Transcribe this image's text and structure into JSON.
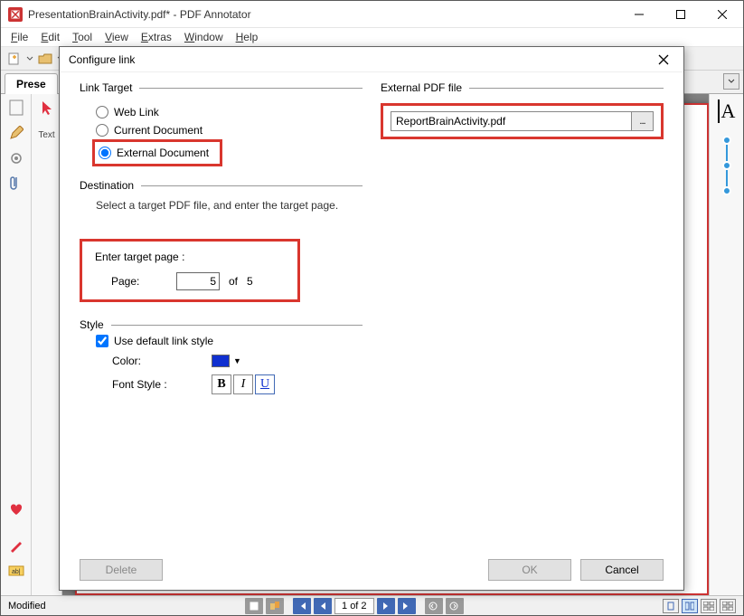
{
  "titlebar": {
    "text": "PresentationBrainActivity.pdf* - PDF Annotator"
  },
  "menu": {
    "items": [
      "File",
      "Edit",
      "Tool",
      "View",
      "Extras",
      "Window",
      "Help"
    ]
  },
  "tab": {
    "label": "Prese"
  },
  "left_label": "Text",
  "font_preview": "A",
  "statusbar": {
    "left": "Modified",
    "page": "1 of 2"
  },
  "dialog": {
    "title": "Configure link",
    "link_target_label": "Link Target",
    "radio_web": "Web Link",
    "radio_current": "Current Document",
    "radio_external": "External Document",
    "destination_label": "Destination",
    "destination_hint": "Select a target PDF file, and enter the target page.",
    "target_section": "Enter target page :",
    "page_label": "Page:",
    "page_value": "5",
    "page_total_prefix": "of",
    "page_total": "5",
    "style_label": "Style",
    "use_default": "Use default link style",
    "color_label": "Color:",
    "font_style_label": "Font Style :",
    "bold": "B",
    "italic": "I",
    "under": "U",
    "external_label": "External PDF file",
    "external_file": "ReportBrainActivity.pdf",
    "browse": "...",
    "delete": "Delete",
    "ok": "OK",
    "cancel": "Cancel"
  }
}
